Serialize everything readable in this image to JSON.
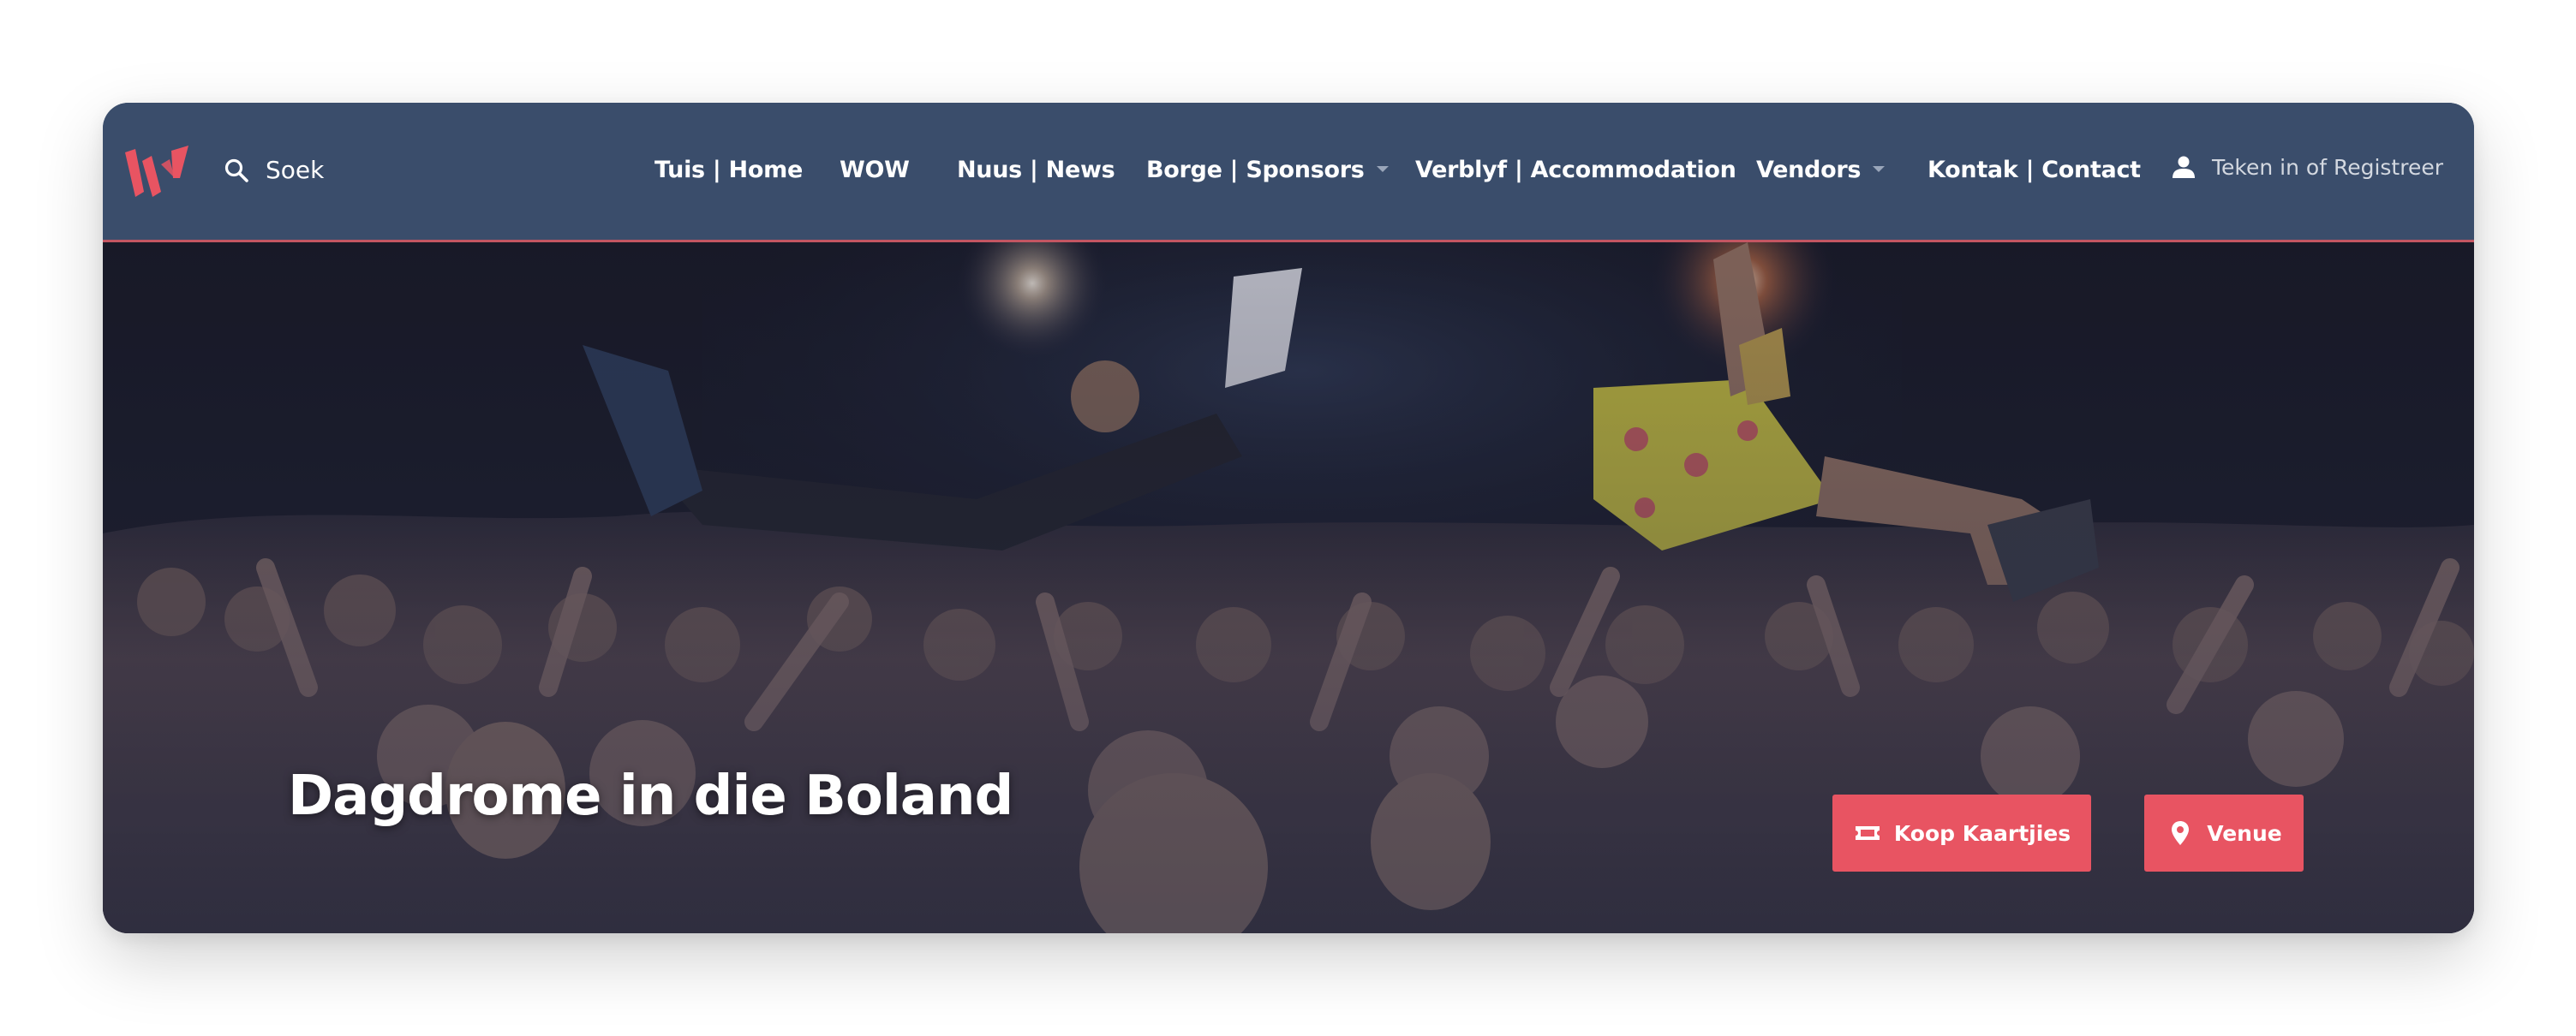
{
  "brand": {
    "logo_icon": "wow-logo-icon",
    "accent": "#e85462",
    "nav_bg": "#3a4d6b"
  },
  "search": {
    "icon": "search-icon",
    "label": "Soek"
  },
  "nav": {
    "items": [
      {
        "label": "Tuis | Home",
        "dropdown": false
      },
      {
        "label": "WOW",
        "dropdown": false
      },
      {
        "label": "Nuus | News",
        "dropdown": false
      },
      {
        "label": "Borge | Sponsors",
        "dropdown": true
      },
      {
        "label": "Verblyf | Accommodation",
        "dropdown": false
      },
      {
        "label": "Vendors",
        "dropdown": true
      },
      {
        "label": "Kontak | Contact",
        "dropdown": false
      }
    ]
  },
  "account": {
    "icon": "user-icon",
    "label": "Teken in of Registreer"
  },
  "hero": {
    "title": "Dagdrome in die Boland",
    "buttons": [
      {
        "label": "Koop Kaartjies",
        "icon": "ticket-icon"
      },
      {
        "label": "Venue",
        "icon": "map-pin-icon"
      }
    ]
  }
}
